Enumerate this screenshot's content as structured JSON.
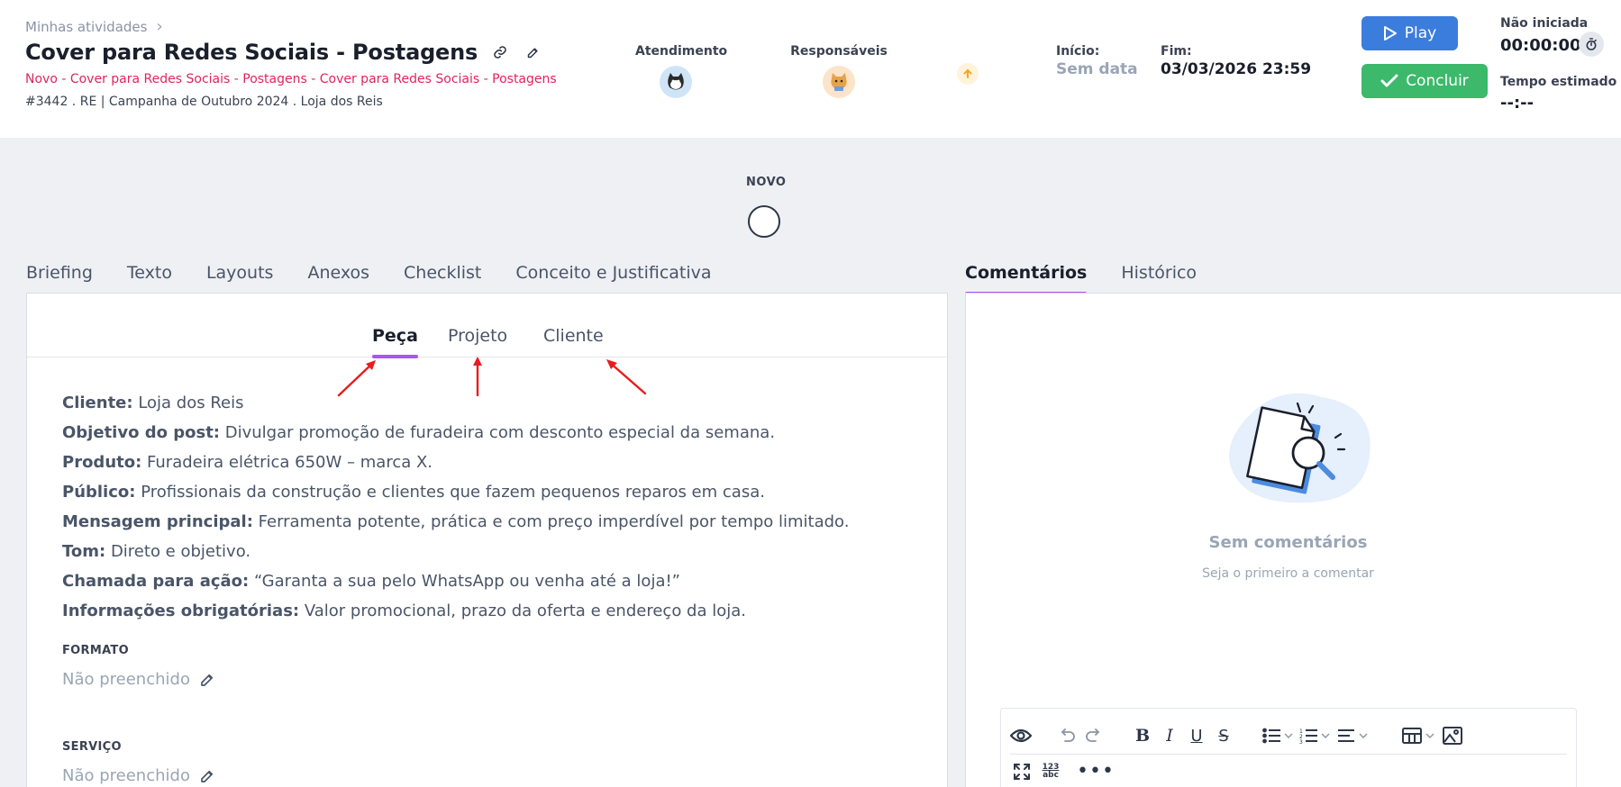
{
  "breadcrumb": {
    "label": "Minhas atividades"
  },
  "task": {
    "title": "Cover para Redes Sociais - Postagens",
    "status_path": "Novo - Cover para Redes Sociais - Postagens - Cover para Redes Sociais - Postagens",
    "meta": "#3442 . RE | Campanha de Outubro 2024 . Loja dos Reis"
  },
  "people": {
    "atendimento_label": "Atendimento",
    "responsaveis_label": "Responsáveis"
  },
  "dates": {
    "inicio_label": "Início:",
    "inicio_value": "Sem data",
    "fim_label": "Fim:",
    "fim_value": "03/03/2026 23:59"
  },
  "actions": {
    "play_label": "Play",
    "concluir_label": "Concluir"
  },
  "timer": {
    "status": "Não iniciada",
    "elapsed": "00:00:00",
    "estimate_label": "Tempo estimado",
    "estimate_value": "--:--"
  },
  "stage": {
    "label": "NOVO"
  },
  "tabs": [
    "Briefing",
    "Texto",
    "Layouts",
    "Anexos",
    "Checklist",
    "Conceito e Justificativa"
  ],
  "right_tabs": [
    "Comentários",
    "Histórico"
  ],
  "subtabs": [
    "Peça",
    "Projeto",
    "Cliente"
  ],
  "brief": [
    {
      "key": "Cliente:",
      "value": " Loja dos Reis"
    },
    {
      "key": "Objetivo do post:",
      "value": " Divulgar promoção de furadeira com desconto especial da semana."
    },
    {
      "key": "Produto:",
      "value": " Furadeira elétrica 650W – marca X."
    },
    {
      "key": "Público:",
      "value": " Profissionais da construção e clientes que fazem pequenos reparos em casa."
    },
    {
      "key": "Mensagem principal:",
      "value": " Ferramenta potente, prática e com preço imperdível por tempo limitado."
    },
    {
      "key": "Tom:",
      "value": " Direto e objetivo."
    },
    {
      "key": "Chamada para ação:",
      "value": " “Garanta a sua pelo WhatsApp ou venha até a loja!”"
    },
    {
      "key": "Informações obrigatórias:",
      "value": " Valor promocional, prazo da oferta e endereço da loja."
    }
  ],
  "fields": {
    "formato_label": "FORMATO",
    "formato_value": "Não preenchido",
    "servico_label": "SERVIÇO",
    "servico_value": "Não preenchido"
  },
  "comments": {
    "empty_title": "Sem comentários",
    "empty_sub": "Seja o primeiro a comentar"
  },
  "editor": {
    "format_badge_top": "123",
    "format_badge_bottom": "abc"
  },
  "colors": {
    "accent_purple": "#a855f7",
    "play_blue": "#3b7ddd",
    "concluir_green": "#3cb96b",
    "status_pink": "#e0245e",
    "annotation_red": "#e81c1c"
  }
}
